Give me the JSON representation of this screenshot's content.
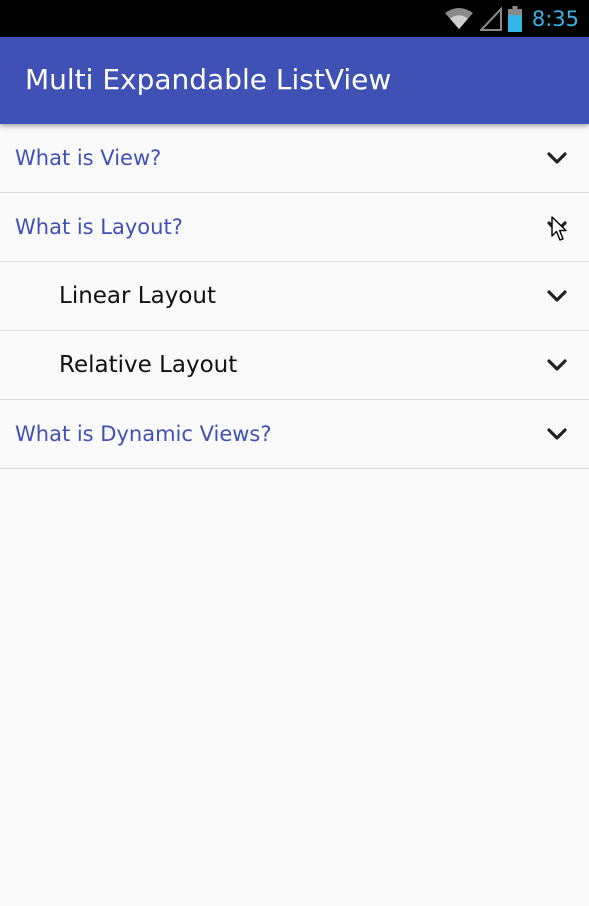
{
  "status_bar": {
    "time": "8:35",
    "icons": [
      "wifi-icon",
      "signal-icon",
      "battery-icon"
    ],
    "time_color": "#33b5e5"
  },
  "app_bar": {
    "title": "Multi Expandable ListView",
    "color": "#3f51b5"
  },
  "list": {
    "items": [
      {
        "label": "What is View?",
        "level": "group",
        "icon": "chevron-down-icon"
      },
      {
        "label": "What is  Layout?",
        "level": "group",
        "icon": "chevron-down-icon"
      },
      {
        "label": "Linear Layout",
        "level": "child",
        "icon": "chevron-down-icon"
      },
      {
        "label": "Relative Layout",
        "level": "child",
        "icon": "chevron-down-icon"
      },
      {
        "label": "What is Dynamic Views?",
        "level": "group",
        "icon": "chevron-down-icon"
      }
    ]
  }
}
